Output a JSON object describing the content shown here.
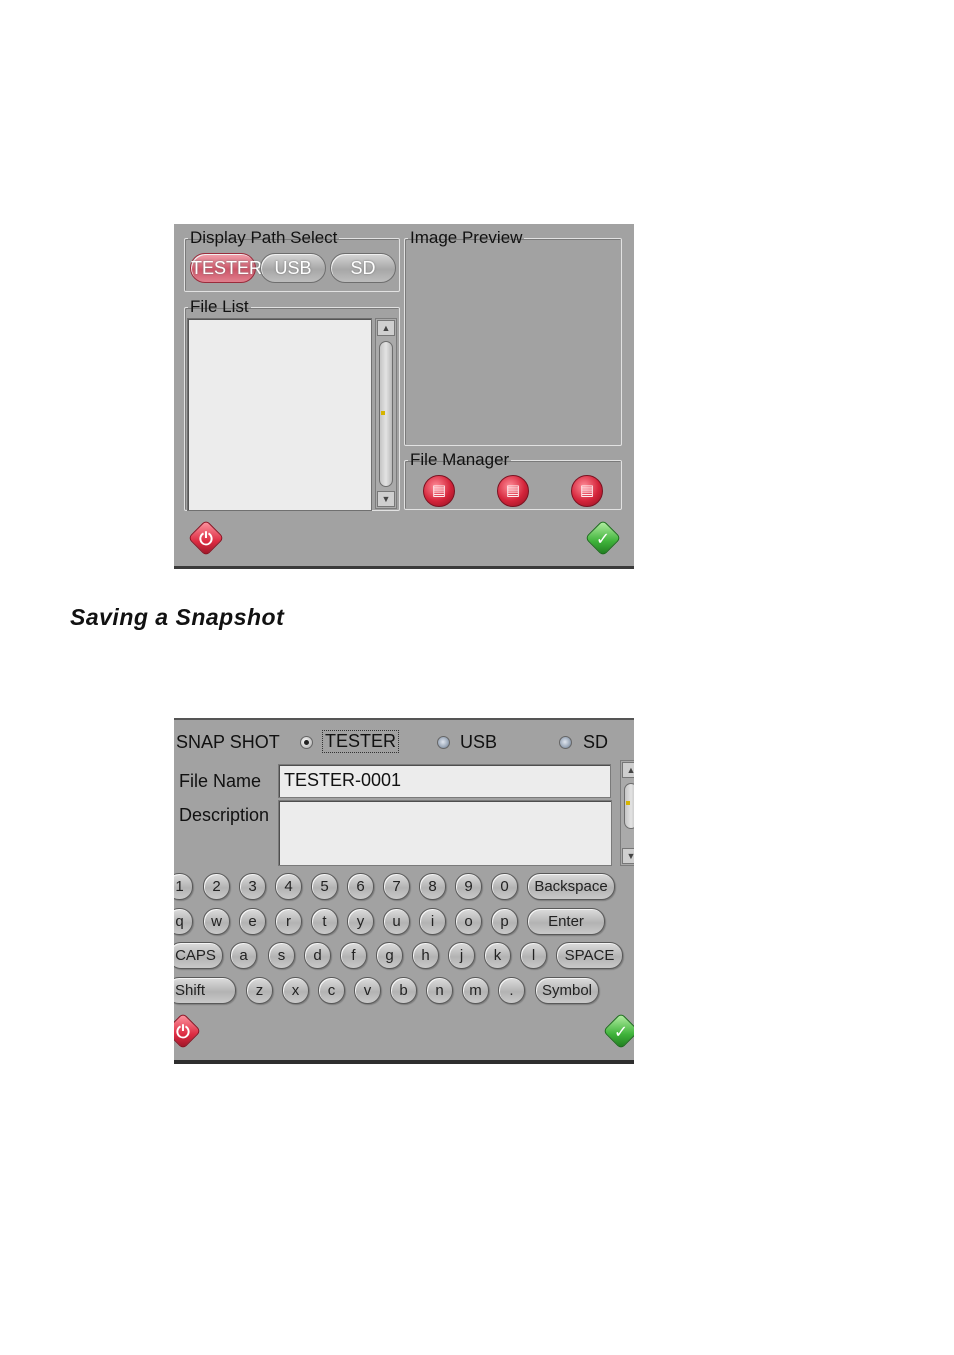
{
  "screen1": {
    "display_path": {
      "title": "Display Path Select",
      "buttons": [
        "TESTER",
        "USB",
        "SD"
      ],
      "selected": "TESTER"
    },
    "file_list": {
      "title": "File List"
    },
    "image_preview": {
      "title": "Image Preview"
    },
    "file_manager": {
      "title": "File Manager",
      "icons": [
        "file-copy-icon",
        "file-move-icon",
        "file-delete-icon"
      ]
    },
    "footer": {
      "cancel_icon": "power-icon",
      "ok_icon": "check-icon"
    }
  },
  "section_heading": "Saving a Snapshot",
  "screen2": {
    "snapshot": {
      "label": "SNAP SHOT",
      "options": [
        "TESTER",
        "USB",
        "SD"
      ],
      "selected": "TESTER"
    },
    "file_name": {
      "label": "File Name",
      "value": "TESTER-0001"
    },
    "description": {
      "label": "Description",
      "value": ""
    },
    "keyboard": {
      "row1": [
        "1",
        "2",
        "3",
        "4",
        "5",
        "6",
        "7",
        "8",
        "9",
        "0"
      ],
      "row1_action": "Backspace",
      "row2": [
        "q",
        "w",
        "e",
        "r",
        "t",
        "y",
        "u",
        "i",
        "o",
        "p"
      ],
      "row2_action": "Enter",
      "row3_lead": "CAPS",
      "row3": [
        "a",
        "s",
        "d",
        "f",
        "g",
        "h",
        "j",
        "k",
        "l"
      ],
      "row3_action": "SPACE",
      "row4_lead": "Shift",
      "row4": [
        "z",
        "x",
        "c",
        "v",
        "b",
        "n",
        "m",
        "."
      ],
      "row4_action": "Symbol"
    },
    "footer": {
      "cancel_icon": "power-icon",
      "ok_icon": "check-icon"
    }
  },
  "colors": {
    "panel_bg": "#a2a2a2",
    "active_button": "#cf5467",
    "ok_green": "#3fb33a",
    "cancel_red": "#d4243a"
  }
}
